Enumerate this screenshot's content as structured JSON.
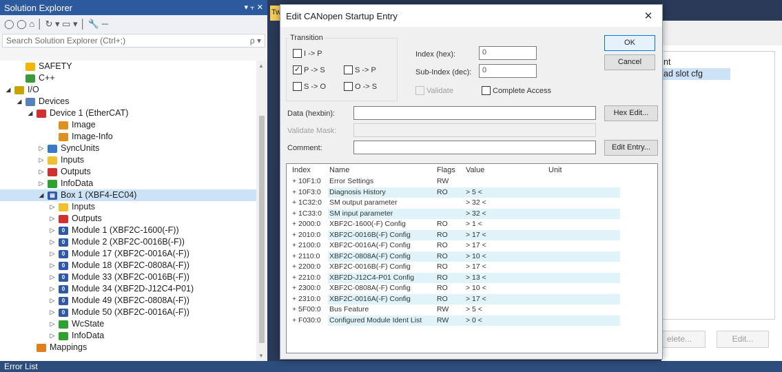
{
  "solution_explorer": {
    "title": "Solution Explorer",
    "pin_glyph": "▾  ⫟  ✕",
    "search_placeholder": "Search Solution Explorer (Ctrl+;)",
    "search_icon": "ρ ▾",
    "tools": "◯ ◯ ⌂ │ ↻ ▾ ▭ ▾ │ 🔧 ─",
    "tree": [
      {
        "label": "SAFETY",
        "indent": 2,
        "icon": "safety",
        "tw": ""
      },
      {
        "label": "C++",
        "indent": 2,
        "icon": "cpp",
        "tw": ""
      },
      {
        "label": "I/O",
        "indent": 1,
        "icon": "io",
        "tw": "◢"
      },
      {
        "label": "Devices",
        "indent": 2,
        "icon": "devices",
        "tw": "◢"
      },
      {
        "label": "Device 1 (EtherCAT)",
        "indent": 3,
        "icon": "ethercat",
        "tw": "◢"
      },
      {
        "label": "Image",
        "indent": 5,
        "icon": "image",
        "tw": ""
      },
      {
        "label": "Image-Info",
        "indent": 5,
        "icon": "image",
        "tw": ""
      },
      {
        "label": "SyncUnits",
        "indent": 4,
        "icon": "sync",
        "tw": "▷"
      },
      {
        "label": "Inputs",
        "indent": 4,
        "icon": "inputs",
        "tw": "▷"
      },
      {
        "label": "Outputs",
        "indent": 4,
        "icon": "outputs",
        "tw": "▷"
      },
      {
        "label": "InfoData",
        "indent": 4,
        "icon": "infodata",
        "tw": "▷"
      },
      {
        "label": "Box 1 (XBF4-EC04)",
        "indent": 4,
        "icon": "box",
        "tw": "◢",
        "selected": true
      },
      {
        "label": "Inputs",
        "indent": 5,
        "icon": "inputs",
        "tw": "▷"
      },
      {
        "label": "Outputs",
        "indent": 5,
        "icon": "outputs",
        "tw": "▷"
      },
      {
        "label": "Module 1 (XBF2C-1600(-F))",
        "indent": 5,
        "icon": "module",
        "tw": "▷"
      },
      {
        "label": "Module 2 (XBF2C-0016B(-F))",
        "indent": 5,
        "icon": "module",
        "tw": "▷"
      },
      {
        "label": "Module 17 (XBF2C-0016A(-F))",
        "indent": 5,
        "icon": "module",
        "tw": "▷"
      },
      {
        "label": "Module 18 (XBF2C-0808A(-F))",
        "indent": 5,
        "icon": "module",
        "tw": "▷"
      },
      {
        "label": "Module 33 (XBF2C-0016B(-F))",
        "indent": 5,
        "icon": "module",
        "tw": "▷"
      },
      {
        "label": "Module 34 (XBF2D-J12C4-P01)",
        "indent": 5,
        "icon": "module",
        "tw": "▷"
      },
      {
        "label": "Module 49 (XBF2C-0808A(-F))",
        "indent": 5,
        "icon": "module",
        "tw": "▷"
      },
      {
        "label": "Module 50 (XBF2C-0016A(-F))",
        "indent": 5,
        "icon": "module",
        "tw": "▷"
      },
      {
        "label": "WcState",
        "indent": 5,
        "icon": "infodata",
        "tw": "▷"
      },
      {
        "label": "InfoData",
        "indent": 5,
        "icon": "infodata",
        "tw": "▷"
      },
      {
        "label": "Mappings",
        "indent": 3,
        "icon": "mappings",
        "tw": ""
      }
    ]
  },
  "error_list": "Error List",
  "right_panel": {
    "tab": "Tw",
    "items": [
      "nt",
      "ad slot cfg"
    ],
    "delete_label": "elete...",
    "edit_label": "Edit..."
  },
  "dialog": {
    "title": "Edit CANopen Startup Entry",
    "close": "✕",
    "transition_label": "Transition",
    "transitions": [
      {
        "label": "I -> P",
        "checked": false
      },
      {
        "label": "P -> S",
        "checked": true
      },
      {
        "label": "S -> P",
        "checked": false
      },
      {
        "label": "S -> O",
        "checked": false
      },
      {
        "label": "O -> S",
        "checked": false
      }
    ],
    "index_label": "Index (hex):",
    "index_value": "0",
    "subindex_label": "Sub-Index (dec):",
    "subindex_value": "0",
    "validate_label": "Validate",
    "complete_access_label": "Complete Access",
    "ok_label": "OK",
    "cancel_label": "Cancel",
    "data_label": "Data (hexbin):",
    "validate_mask_label": "Validate Mask:",
    "comment_label": "Comment:",
    "hex_edit_label": "Hex Edit...",
    "edit_entry_label": "Edit Entry...",
    "columns": [
      "Index",
      "Name",
      "Flags",
      "Value",
      "Unit"
    ],
    "rows": [
      {
        "index": "+ 10F1:0",
        "name": "Error Settings",
        "flags": "RW",
        "value": "",
        "alt": false
      },
      {
        "index": "+ 10F3:0",
        "name": "Diagnosis History",
        "flags": "RO",
        "value": "> 5 <",
        "alt": true
      },
      {
        "index": "+ 1C32:0",
        "name": "SM output parameter",
        "flags": "",
        "value": "> 32 <",
        "alt": false
      },
      {
        "index": "+ 1C33:0",
        "name": "SM input parameter",
        "flags": "",
        "value": "> 32 <",
        "alt": true
      },
      {
        "index": "+ 2000:0",
        "name": "XBF2C-1600(-F) Config",
        "flags": "RO",
        "value": "> 1 <",
        "alt": false
      },
      {
        "index": "+ 2010:0",
        "name": "XBF2C-0016B(-F) Config",
        "flags": "RO",
        "value": "> 17 <",
        "alt": true
      },
      {
        "index": "+ 2100:0",
        "name": "XBF2C-0016A(-F) Config",
        "flags": "RO",
        "value": "> 17 <",
        "alt": false
      },
      {
        "index": "+ 2110:0",
        "name": "XBF2C-0808A(-F) Config",
        "flags": "RO",
        "value": "> 10 <",
        "alt": true
      },
      {
        "index": "+ 2200:0",
        "name": "XBF2C-0016B(-F) Config",
        "flags": "RO",
        "value": "> 17 <",
        "alt": false
      },
      {
        "index": "+ 2210:0",
        "name": "XBF2D-J12C4-P01 Config",
        "flags": "RO",
        "value": "> 13 <",
        "alt": true
      },
      {
        "index": "+ 2300:0",
        "name": "XBF2C-0808A(-F) Config",
        "flags": "RO",
        "value": "> 10 <",
        "alt": false
      },
      {
        "index": "+ 2310:0",
        "name": "XBF2C-0016A(-F) Config",
        "flags": "RO",
        "value": "> 17 <",
        "alt": true
      },
      {
        "index": "+ 5F00:0",
        "name": "Bus Feature",
        "flags": "RW",
        "value": "> 5 <",
        "alt": false
      },
      {
        "index": "+ F030:0",
        "name": "Configured Module Ident List",
        "flags": "RW",
        "value": "> 0 <",
        "alt": true
      }
    ]
  }
}
